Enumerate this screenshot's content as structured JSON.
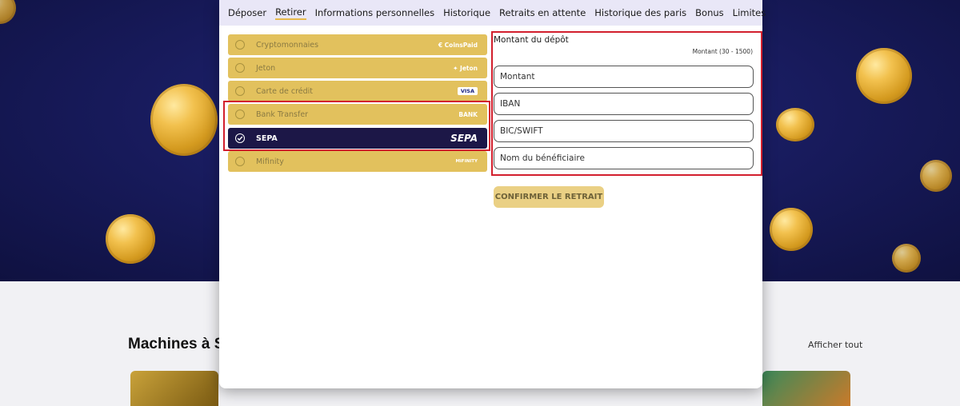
{
  "tabs": [
    {
      "label": "Déposer"
    },
    {
      "label": "Retirer"
    },
    {
      "label": "Informations personnelles"
    },
    {
      "label": "Historique"
    },
    {
      "label": "Retraits en attente"
    },
    {
      "label": "Historique des paris"
    },
    {
      "label": "Bonus"
    },
    {
      "label": "Limites"
    }
  ],
  "active_tab": "Retirer",
  "methods": [
    {
      "label": "Cryptomonnaies",
      "logo": "€ CoinsPaid"
    },
    {
      "label": "Jeton",
      "logo": "✦ Jeton"
    },
    {
      "label": "Carte de crédit",
      "logo": "VISA"
    },
    {
      "label": "Bank Transfer",
      "logo": "BANK"
    },
    {
      "label": "SEPA",
      "logo": "SEPA"
    },
    {
      "label": "Mifinity",
      "logo": "MiFINITY"
    }
  ],
  "selected_method": "SEPA",
  "form": {
    "title": "Montant du dépôt",
    "range": "Montant (30 - 1500)",
    "amount_placeholder": "Montant",
    "iban_placeholder": "IBAN",
    "bic_placeholder": "BIC/SWIFT",
    "beneficiary_placeholder": "Nom du bénéficiaire",
    "confirm_label": "CONFIRMER LE RETRAIT"
  },
  "background": {
    "section_title": "Machines à S",
    "see_all": "Afficher tout"
  },
  "colors": {
    "accent_gold": "#e2c15d",
    "selected_navy": "#1c1747",
    "highlight_red": "#d21f2d"
  }
}
